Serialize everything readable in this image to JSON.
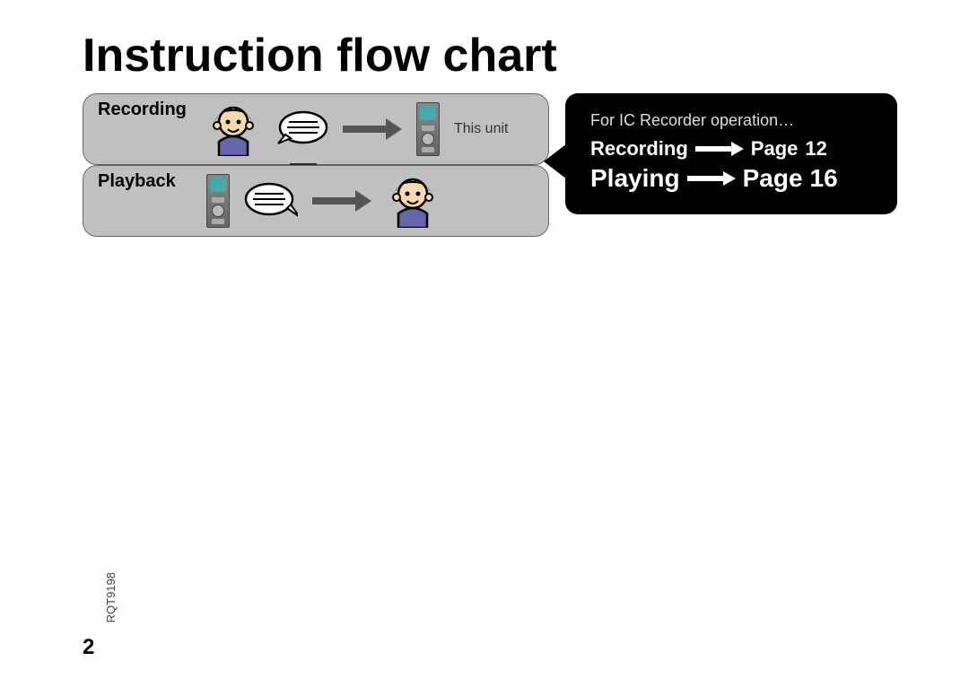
{
  "title": "Instruction flow chart",
  "flow": {
    "recording": {
      "label": "Recording",
      "arrow_to": "This unit"
    },
    "playback": {
      "label": "Playback"
    },
    "device_caption": "This unit"
  },
  "callout": {
    "header": "For IC Recorder operation…",
    "lines": [
      {
        "action": "Recording",
        "page_word": "Page",
        "page_num": "12"
      },
      {
        "action": "Playing",
        "page_word": "Page",
        "page_num": "16"
      }
    ]
  },
  "page_number": "2",
  "doc_code": "RQT9198"
}
